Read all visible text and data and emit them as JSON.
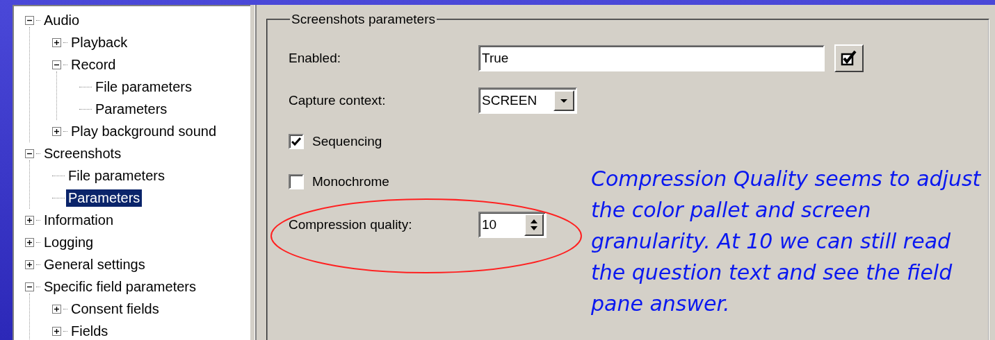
{
  "tree": [
    {
      "label": "Audio",
      "expanded": true,
      "selected": false,
      "children": [
        {
          "label": "Playback",
          "expanded": false,
          "selected": false
        },
        {
          "label": "Record",
          "expanded": true,
          "selected": false,
          "children": [
            {
              "label": "File parameters",
              "selected": false
            },
            {
              "label": "Parameters",
              "selected": false
            }
          ]
        },
        {
          "label": "Play background sound",
          "expanded": false,
          "selected": false
        }
      ]
    },
    {
      "label": "Screenshots",
      "expanded": true,
      "selected": false,
      "children": [
        {
          "label": "File parameters",
          "selected": false
        },
        {
          "label": "Parameters",
          "selected": true
        }
      ]
    },
    {
      "label": "Information",
      "expanded": false,
      "selected": false
    },
    {
      "label": "Logging",
      "expanded": false,
      "selected": false
    },
    {
      "label": "General settings",
      "expanded": false,
      "selected": false
    },
    {
      "label": "Specific field parameters",
      "expanded": true,
      "selected": false,
      "children": [
        {
          "label": "Consent fields",
          "expanded": false,
          "selected": false
        },
        {
          "label": "Fields",
          "expanded": false,
          "selected": false
        }
      ]
    }
  ],
  "group": {
    "title": "Screenshots parameters",
    "fields": [
      {
        "kind": "text",
        "label": "Enabled:",
        "value": "True",
        "checked": true
      },
      {
        "kind": "select",
        "label": "Capture context:",
        "value": "SCREEN"
      },
      {
        "kind": "checkbox",
        "label": "Sequencing",
        "checked": true
      },
      {
        "kind": "checkbox",
        "label": "Monochrome",
        "checked": false
      },
      {
        "kind": "spinner",
        "label": "Compression quality:",
        "value": "10",
        "highlighted": true
      }
    ]
  },
  "annotation": "Compression Quality seems to adjust the color pallet and screen granularity. At 10 we can still read the question text and see the field pane answer."
}
